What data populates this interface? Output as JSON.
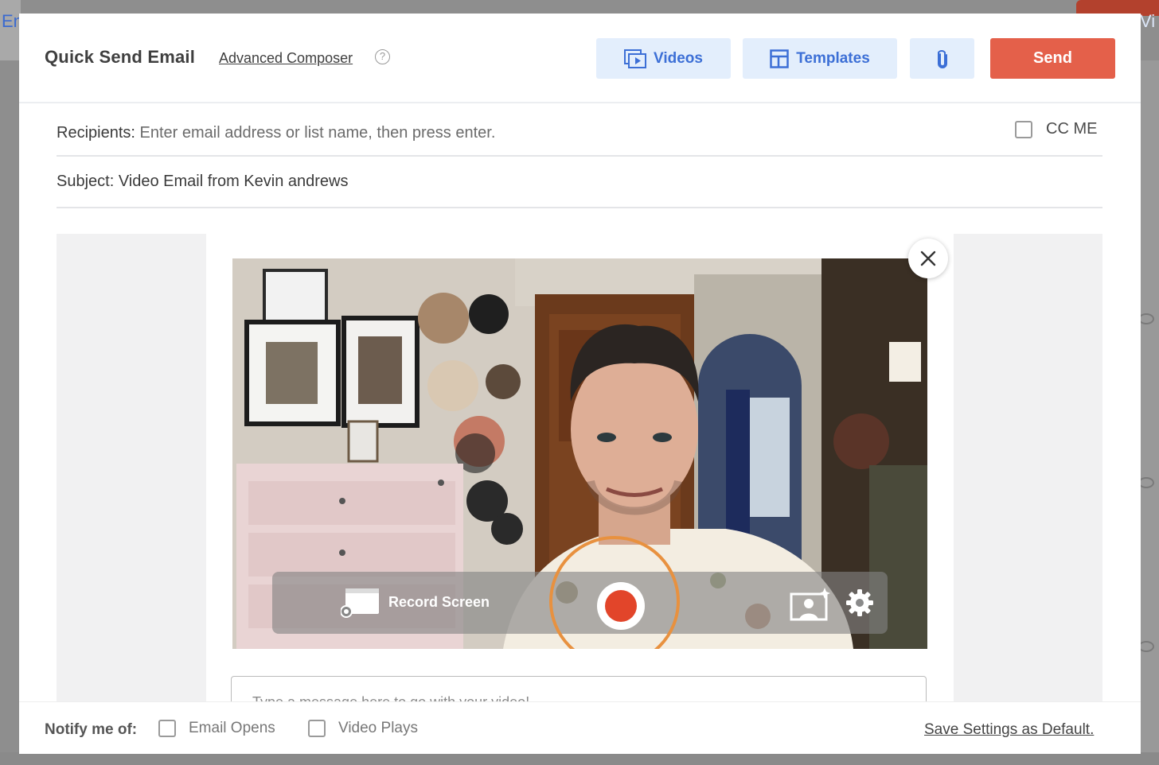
{
  "background": {
    "left_fragment": "En",
    "right_fragment": "Vi"
  },
  "header": {
    "title": "Quick Send Email",
    "advanced_link": "Advanced Composer",
    "help_icon": "question-circle-icon",
    "buttons": {
      "videos": "Videos",
      "templates": "Templates",
      "attach_icon": "paperclip-icon",
      "send": "Send"
    }
  },
  "form": {
    "recipients_label": "Recipients:",
    "recipients_placeholder": "Enter email address or list name, then press enter.",
    "cc_me": "CC ME",
    "subject_label": "Subject:",
    "subject_value": "Video Email from Kevin andrews"
  },
  "recorder": {
    "record_screen_label": "Record Screen",
    "close_icon": "close-icon",
    "record_icon": "record-icon",
    "virtual_background_icon": "image-sparkle-icon",
    "settings_icon": "gear-icon"
  },
  "message": {
    "placeholder": "Type a message here to go with your video!"
  },
  "footer": {
    "notify_label": "Notify me of:",
    "email_opens": "Email Opens",
    "video_plays": "Video Plays",
    "save_settings": "Save Settings as Default."
  },
  "colors": {
    "accent": "#3c6fd6",
    "send": "#e4604a",
    "record": "#e2452a",
    "ring": "#e8913f"
  }
}
